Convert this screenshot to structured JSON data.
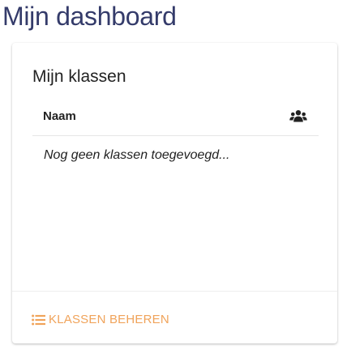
{
  "page": {
    "title": "Mijn dashboard"
  },
  "card": {
    "title": "Mijn klassen",
    "table": {
      "columns": [
        "Naam"
      ],
      "member_icon": "users-icon"
    },
    "empty_message": "Nog geen klassen toegevoegd...",
    "footer": {
      "manage_label": "KLASSEN BEHEREN",
      "manage_icon": "list-icon"
    }
  },
  "colors": {
    "title": "#343b6a",
    "accent": "#f0a35a",
    "text": "#222222"
  }
}
